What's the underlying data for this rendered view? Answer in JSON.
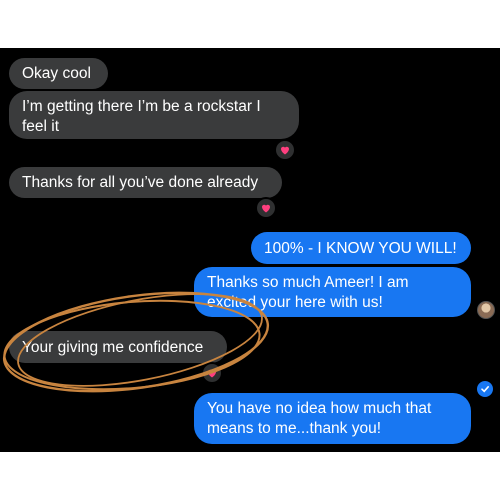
{
  "messages": [
    {
      "text": "Okay cool",
      "from": "other"
    },
    {
      "text": "I’m getting there I’m be a rockstar I",
      "text2": "feel it",
      "from": "other",
      "reaction": "heart"
    },
    {
      "text": "Thanks for all you’ve done already",
      "from": "other",
      "reaction": "heart"
    },
    {
      "text": "100% - I KNOW YOU WILL!",
      "from": "me"
    },
    {
      "text": "Thanks so much Ameer! I am",
      "text2": "excited your here with us!",
      "from": "me"
    },
    {
      "text": "Your giving me confidence",
      "from": "other",
      "reaction": "heart",
      "circled": true
    },
    {
      "text": "You have no idea how much that",
      "text2": "means to me...thank you!",
      "from": "me",
      "status": "read"
    }
  ],
  "colors": {
    "background": "#000000",
    "incoming_bubble": "#3a3b3c",
    "outgoing_bubble": "#1877f2",
    "reaction_heart": "#ff3f7f",
    "annotation_circle": "#c8843f"
  },
  "icons": {
    "reaction": "heart-icon",
    "seen_avatar": "avatar",
    "delivered": "check-circle-icon"
  }
}
